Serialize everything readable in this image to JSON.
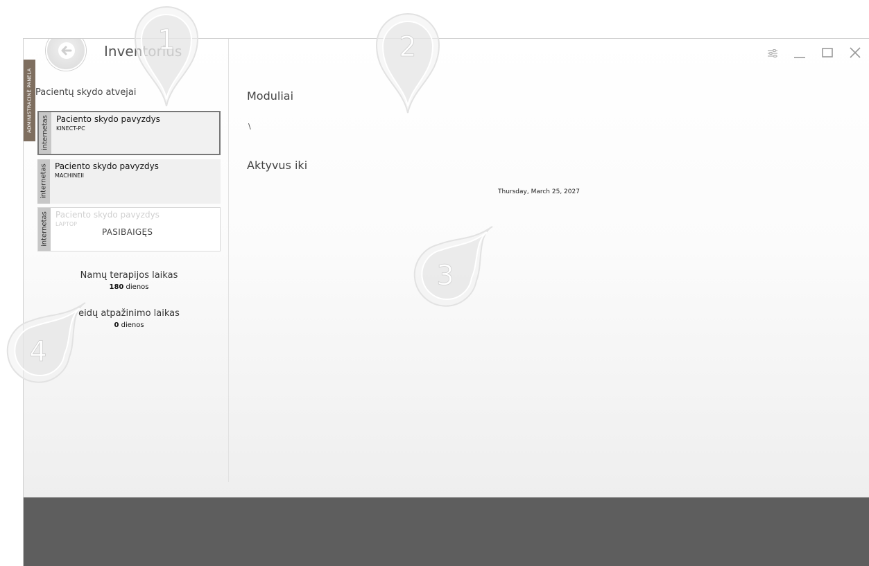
{
  "window": {
    "title": "Inventorius",
    "admin_tab": "ADMINISTRACINĖ PANELA"
  },
  "controls": {
    "settings_icon": "settings-sliders-icon",
    "minimize_icon": "minimize-icon",
    "maximize_icon": "maximize-icon",
    "close_icon": "close-icon"
  },
  "sidebar": {
    "heading": "Pacientų skydo atvejai",
    "cases": [
      {
        "type": "internetas",
        "title": "Paciento skydo pavyzdys",
        "machine": "KINECT-PC",
        "status": ""
      },
      {
        "type": "internetas",
        "title": "Paciento skydo pavyzdys",
        "machine": "MACHINEII",
        "status": ""
      },
      {
        "type": "internetas",
        "title": "Paciento skydo pavyzdys",
        "machine": "LAPTOP",
        "status": "PASIBAIGĘS"
      }
    ],
    "stats": [
      {
        "label": "Namų terapijos laikas",
        "value": "180",
        "unit": "dienos"
      },
      {
        "label": "eidų atpažinimo laikas",
        "value": "0",
        "unit": "dienos"
      }
    ]
  },
  "main": {
    "modules_title": "Moduliai",
    "modules_value": "\\",
    "active_title": "Aktyvus iki",
    "active_date": "Thursday, March 25, 2027"
  },
  "callouts": [
    "1",
    "2",
    "3",
    "4"
  ],
  "colors": {
    "admin_tab": "#7e6e5f",
    "footer": "#5e5e5e",
    "card_strip": "#c7c7c7"
  }
}
